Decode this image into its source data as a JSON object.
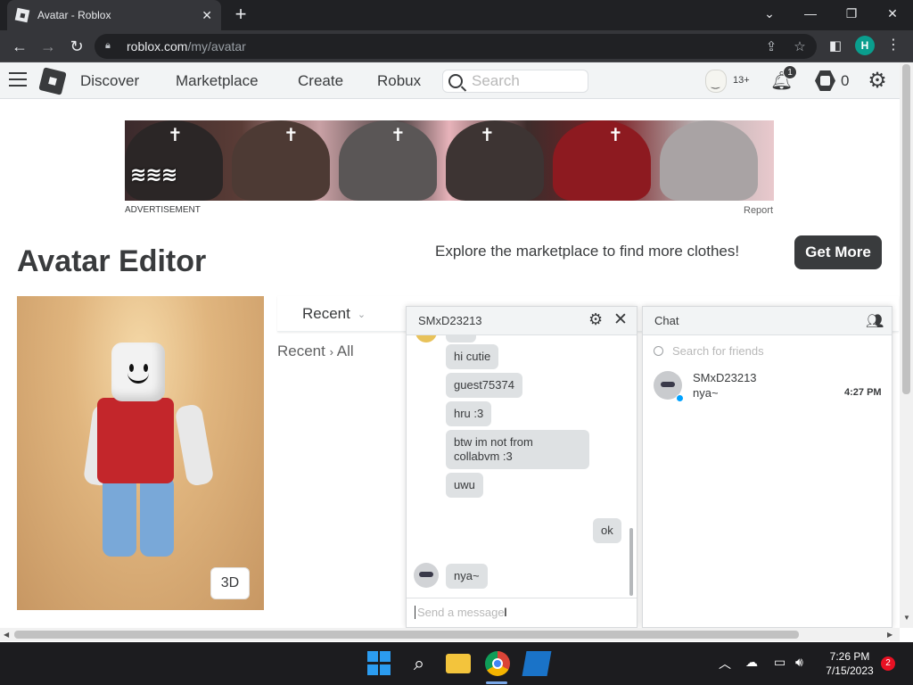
{
  "browser": {
    "tab_title": "Avatar - Roblox",
    "url_host": "roblox.com",
    "url_path": "/my/avatar",
    "profile_initial": "H"
  },
  "nav": {
    "links": [
      "Discover",
      "Marketplace",
      "Create",
      "Robux"
    ],
    "search_placeholder": "Search",
    "age_label": "13+",
    "notification_count": "1",
    "robux_count": "0"
  },
  "ad": {
    "label": "ADVERTISEMENT",
    "report": "Report"
  },
  "editor": {
    "title": "Avatar Editor",
    "explore_text": "Explore the marketplace to find more clothes!",
    "get_more": "Get More",
    "view_3d": "3D",
    "category_tab": "Recent",
    "breadcrumb_1": "Recent",
    "breadcrumb_2": "All"
  },
  "conversation": {
    "title": "SMxD23213",
    "messages": [
      {
        "text": "hi cutie",
        "side": "left"
      },
      {
        "text": "guest75374",
        "side": "left"
      },
      {
        "text": "hru :3",
        "side": "left"
      },
      {
        "text": "btw im not from collabvm :3",
        "side": "left"
      },
      {
        "text": "uwu",
        "side": "left"
      },
      {
        "text": "ok",
        "side": "right"
      },
      {
        "text": "nya~",
        "side": "left"
      }
    ],
    "input_placeholder": "Send a message"
  },
  "chat": {
    "title": "Chat",
    "search_placeholder": "Search for friends",
    "friends": [
      {
        "name": "SMxD23213",
        "last_message": "nya~",
        "time": "4:27 PM"
      }
    ]
  },
  "taskbar": {
    "time": "7:26 PM",
    "date": "7/15/2023",
    "notification_count": "2"
  },
  "colors": {
    "roblox_text": "#393b3d",
    "bubble": "#dee1e3",
    "start_blue": "#2b9cf0"
  }
}
